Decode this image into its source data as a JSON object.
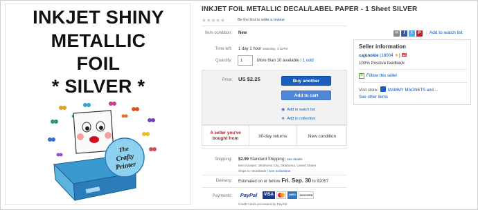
{
  "image": {
    "title_lines": [
      "INKJET SHINY",
      "METALLIC",
      "FOIL",
      "* SILVER *"
    ],
    "badge_lines": [
      "The",
      "Crafty",
      "Printer"
    ]
  },
  "listing": {
    "title": "INKJET FOIL METALLIC DECAL/LABEL PAPER - 1 Sheet SILVER",
    "review_prefix": "Be the first to ",
    "review_link": "write a review"
  },
  "details": {
    "condition_label": "Item condition:",
    "condition_value": "New",
    "time_label": "Time left:",
    "time_value": "1 day 1 hour",
    "time_detail": "Saturday, 4:11PM",
    "quantity_label": "Quantity:",
    "quantity_value": "1",
    "availability": "More than 10 available",
    "sold_sep": " / ",
    "sold": "1 sold"
  },
  "buybox": {
    "price_label": "Price:",
    "price_value": "US $2.25",
    "buy_button": "Buy another",
    "cart_button": "Add to cart",
    "watch_link": "Add to watch list",
    "collection_link": "Add to collection"
  },
  "info_strip": {
    "seller_loved": "A seller you've bought from",
    "returns": "30-day returns",
    "condition": "New condition"
  },
  "shipping": {
    "label": "Shipping:",
    "cost": "$2.99",
    "method": "Standard Shipping",
    "pipe": " | ",
    "details_link": "See details",
    "location": "Item location: Oklahoma City, Oklahoma, United States",
    "ships_to_prefix": "Ships to: Worldwide",
    "exclusions_link": "See exclusions"
  },
  "delivery": {
    "label": "Delivery:",
    "estimate_prefix": "Estimated on or before ",
    "date": "Fri. Sep. 30",
    "to_zip": " to 92057"
  },
  "payments": {
    "label": "Payments:",
    "paypal": "PayPal",
    "visa": "VISA",
    "amex": "AMEX",
    "discover": "DISCOVER",
    "note": "Credit Cards processed by PayPal"
  },
  "share": {
    "watch_link": "Add to watch list",
    "pipe": "|"
  },
  "seller": {
    "title": "Seller information",
    "name": "cajunokie",
    "feedback_score": "(18004",
    "feedback_close": ")",
    "positive": "100% Positive feedback",
    "follow": "Follow this seller",
    "store_label": "Visit store:",
    "store_name": "MAMMY MAGNETS and ...",
    "other_items": "See other items"
  },
  "colors": {
    "ebay_blue": "#0654ba",
    "button_blue": "#1a5fbf",
    "alert_red": "#c21010"
  }
}
